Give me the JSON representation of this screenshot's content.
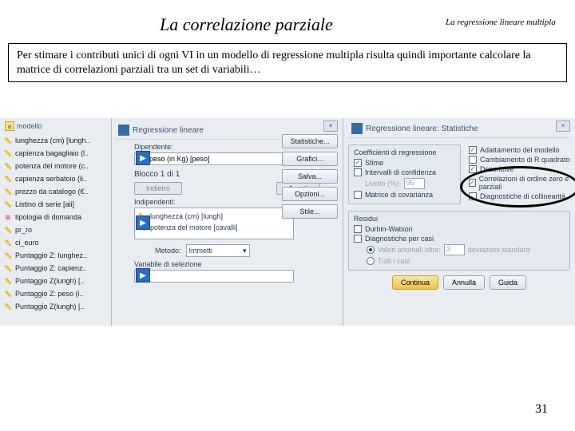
{
  "slide": {
    "title": "La correlazione parziale",
    "subtitle": "La regressione lineare multipla",
    "body": "Per stimare i contributi unici di ogni VI in un modello di regressione multipla risulta quindi importante calcolare la matrice di correlazioni parziali tra un set di variabili…",
    "page": "31"
  },
  "varlist": {
    "header": "modello",
    "items": [
      {
        "icon": "scale",
        "label": "lunghezza (cm) [lungh.."
      },
      {
        "icon": "scale",
        "label": "capienza bagagliaio (l.."
      },
      {
        "icon": "scale",
        "label": "potenza del motore (c.."
      },
      {
        "icon": "scale",
        "label": "capienza serbatoio (li.."
      },
      {
        "icon": "scale",
        "label": "prezzo da catalogo (€.."
      },
      {
        "icon": "scale",
        "label": "Listino di serie [ali]"
      },
      {
        "icon": "nom",
        "label": "tipologia di domanda"
      },
      {
        "icon": "scale",
        "label": "pr_ro"
      },
      {
        "icon": "scale",
        "label": "ci_euro"
      },
      {
        "icon": "scale",
        "label": "Puntaggio Z: lunghez.."
      },
      {
        "icon": "scale",
        "label": "Puntaggio Z: capienz.."
      },
      {
        "icon": "scale",
        "label": "Puntaggio Z(lungh) [.."
      },
      {
        "icon": "scale",
        "label": "Puntaggio Z: peso (i.."
      },
      {
        "icon": "scale",
        "label": "Puntaggio Z(lungh) [.."
      }
    ]
  },
  "dlg1": {
    "title": "Regressione lineare",
    "close": "×",
    "dep_label": "Dipendente:",
    "dep_value": "peso (in Kg) [peso]",
    "block": "Blocco 1 di 1",
    "prev": "Indietro",
    "next": "Avanti",
    "indep_label": "Indipendenti:",
    "indep_items": [
      "lunghezza (cm) [lungh]",
      "potenza del motore [cavalli]"
    ],
    "method_label": "Metodo:",
    "method_value": "Immetti",
    "selvar_label": "Variabile di selezione",
    "buttons": [
      "Statistiche...",
      "Grafici...",
      "Salva...",
      "Opzioni...",
      "Stile..."
    ]
  },
  "dlg2": {
    "title": "Regressione lineare: Statistiche",
    "close": "×",
    "coef_title": "Coefficienti di regressione",
    "col1": [
      {
        "checked": true,
        "label": "Stime"
      },
      {
        "checked": false,
        "label": "Intervalli di confidenza"
      },
      {
        "sub": true,
        "label": "Livello (%):",
        "value": "95"
      },
      {
        "checked": false,
        "label": "Matrice di covarianza"
      }
    ],
    "col2": [
      {
        "checked": true,
        "label": "Adattamento del modello"
      },
      {
        "checked": false,
        "label": "Cambiamento di R quadrato"
      },
      {
        "checked": true,
        "label": "Descrittive"
      },
      {
        "checked": true,
        "label": "Correlazioni di ordine zero e parziali"
      },
      {
        "checked": false,
        "label": "Diagnostiche di collinearità"
      }
    ],
    "res_title": "Residui",
    "res": [
      {
        "checked": false,
        "label": "Durbin-Watson"
      },
      {
        "checked": false,
        "label": "Diagnostiche per casi"
      }
    ],
    "outlier_label": "Valori anomali oltre:",
    "outlier_value": "3",
    "outlier_unit": "deviazioni standard",
    "allcases": "Tutti i casi",
    "btns": {
      "cont": "Continua",
      "ann": "Annulla",
      "guida": "Guida"
    }
  }
}
